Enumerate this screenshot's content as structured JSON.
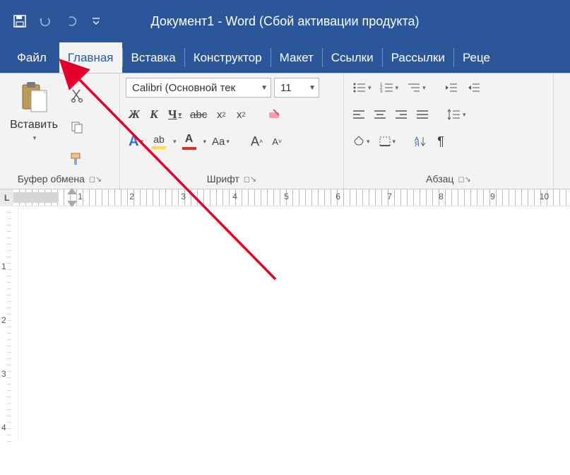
{
  "title": "Документ1  -  Word (Сбой активации продукта)",
  "tabs": {
    "file": "Файл",
    "home": "Главная",
    "insert": "Вставка",
    "design": "Конструктор",
    "layout": "Макет",
    "references": "Ссылки",
    "mailings": "Рассылки",
    "review": "Реце"
  },
  "ribbon": {
    "clipboard": {
      "paste": "Вставить",
      "label": "Буфер обмена"
    },
    "font": {
      "name": "Calibri (Основной тек",
      "size": "11",
      "bold": "Ж",
      "italic": "К",
      "underline": "Ч",
      "strike": "abc",
      "sub": "x",
      "sup": "x",
      "color_letter": "А",
      "case": "Aa",
      "grow": "A",
      "shrink": "A",
      "hl_letter": "ab",
      "label": "Шрифт"
    },
    "para": {
      "label": "Абзац"
    }
  },
  "ruler": {
    "corner": "L",
    "nums": [
      "",
      "1",
      "2",
      "3",
      "4",
      "5",
      "6",
      "7",
      "8",
      "9",
      "10"
    ]
  },
  "vruler": {
    "nums": [
      "",
      "1",
      "2",
      "3",
      "4"
    ]
  }
}
